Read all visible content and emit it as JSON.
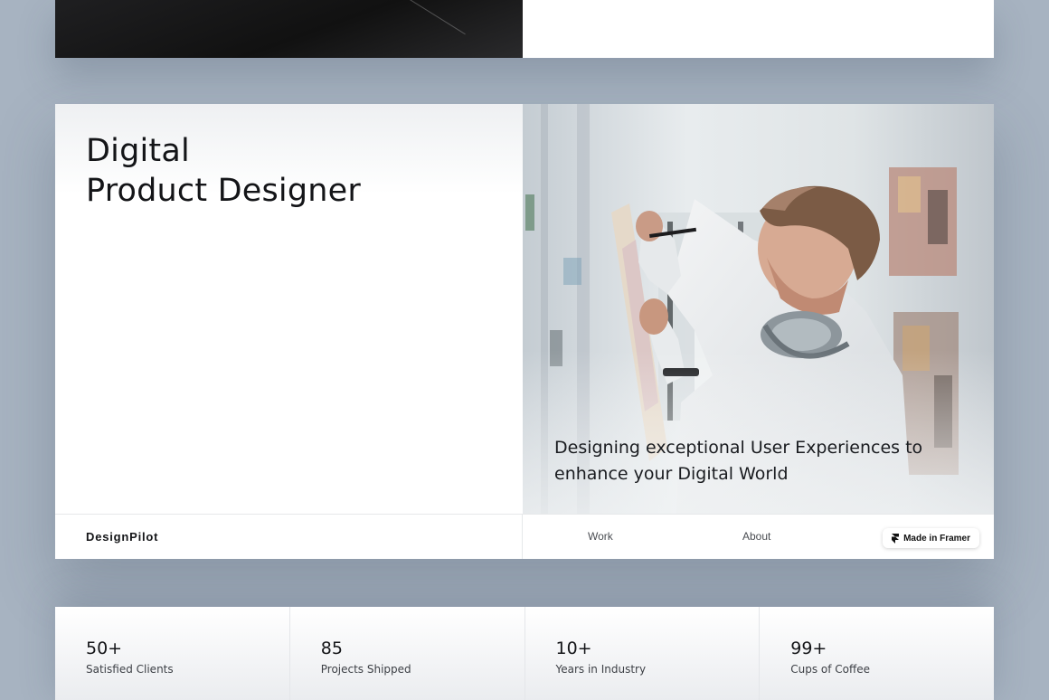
{
  "hero": {
    "title_line1": "Digital",
    "title_line2": "Product Designer",
    "tagline": "Designing exceptional User Experiences to enhance your Digital World",
    "photo_icon": "designer-at-whiteboard-photo"
  },
  "footer": {
    "brand": "DesignPilot",
    "nav": [
      {
        "label": "Work"
      },
      {
        "label": "About"
      }
    ],
    "badge_label": "Made in Framer",
    "badge_icon": "framer-logo-icon"
  },
  "stats": [
    {
      "value": "50+",
      "label": "Satisfied Clients"
    },
    {
      "value": "85",
      "label": "Projects Shipped"
    },
    {
      "value": "10+",
      "label": "Years in Industry"
    },
    {
      "value": "99+",
      "label": "Cups of Coffee"
    }
  ],
  "colors": {
    "background": "#a7b3c1",
    "text": "#141518",
    "card": "#ffffff",
    "dark_panel": "#1a1a1c"
  }
}
